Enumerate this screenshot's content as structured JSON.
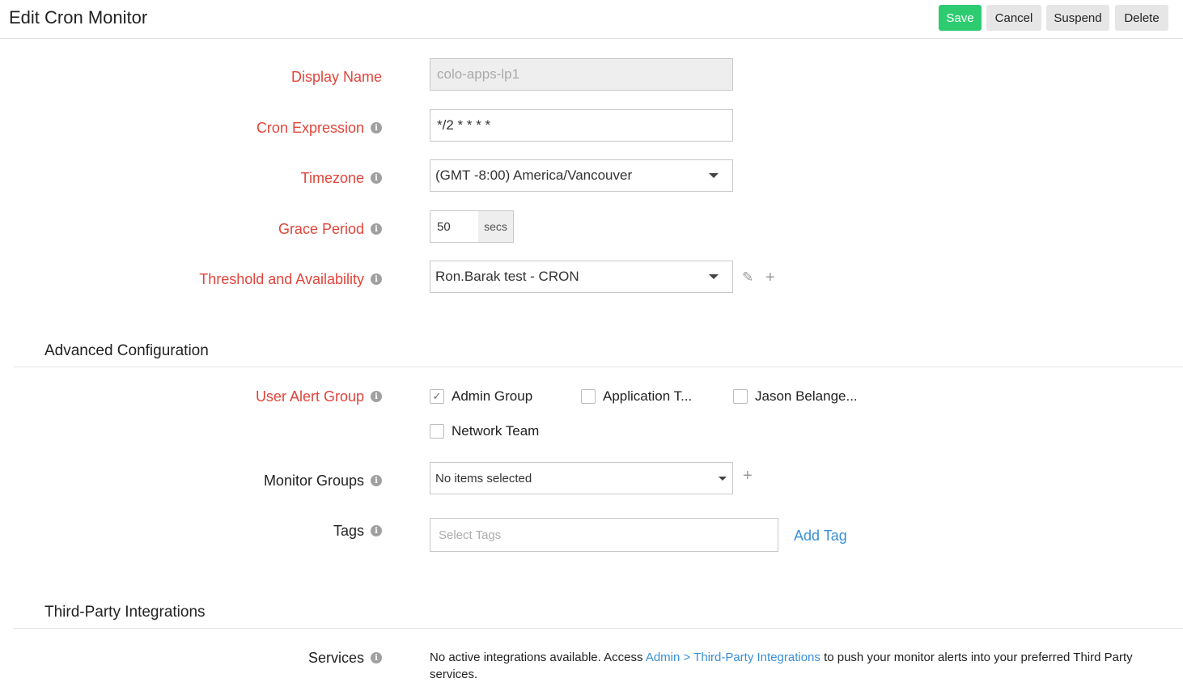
{
  "header": {
    "title": "Edit Cron Monitor",
    "save_label": "Save",
    "cancel_label": "Cancel",
    "suspend_label": "Suspend",
    "delete_label": "Delete"
  },
  "form": {
    "display_name": {
      "label": "Display Name",
      "value": "colo-apps-lp1"
    },
    "cron_expression": {
      "label": "Cron Expression",
      "value": "*/2 * * * *"
    },
    "timezone": {
      "label": "Timezone",
      "value": "(GMT -8:00) America/Vancouver"
    },
    "grace_period": {
      "label": "Grace Period",
      "value": "50",
      "unit": "secs"
    },
    "threshold": {
      "label": "Threshold and Availability",
      "value": "Ron.Barak test - CRON"
    }
  },
  "advanced": {
    "title": "Advanced Configuration",
    "user_alert_group": {
      "label": "User Alert Group",
      "options": [
        {
          "label": "Admin Group",
          "checked": true
        },
        {
          "label": "Application T...",
          "checked": false
        },
        {
          "label": "Jason Belange...",
          "checked": false
        },
        {
          "label": "Network Team",
          "checked": false
        }
      ]
    },
    "monitor_groups": {
      "label": "Monitor Groups",
      "value": "No items selected"
    },
    "tags": {
      "label": "Tags",
      "placeholder": "Select Tags",
      "add_label": "Add Tag"
    }
  },
  "integrations": {
    "title": "Third-Party Integrations",
    "services_label": "Services",
    "text_before": "No active integrations available. Access ",
    "link": "Admin > Third-Party Integrations",
    "text_after": " to push your monitor alerts into your preferred Third Party services."
  },
  "colors": {
    "primary": "#2ecc71",
    "required_label": "#e2443a",
    "link": "#3a8fd6"
  }
}
